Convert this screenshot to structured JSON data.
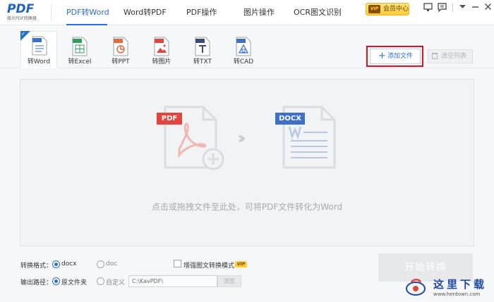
{
  "logo": {
    "main": "PDF",
    "sub": "极光PDF转换器"
  },
  "nav": {
    "tabs": [
      {
        "label": "PDF转Word"
      },
      {
        "label": "Word转PDF"
      },
      {
        "label": "PDF操作"
      },
      {
        "label": "图片操作"
      },
      {
        "label": "OCR图文识别"
      }
    ],
    "active_index": 0
  },
  "topbar": {
    "vip_label": "会员中心",
    "vip_badge": "VIP"
  },
  "tools": [
    {
      "label": "转Word",
      "tag": "DOC",
      "color": "#3c71c9"
    },
    {
      "label": "转Excel",
      "tag": "XLS",
      "color": "#2f9e5a"
    },
    {
      "label": "转PPT",
      "tag": "PPT",
      "color": "#e8693c"
    },
    {
      "label": "转图片",
      "tag": "JPG",
      "color": "#e8423c"
    },
    {
      "label": "转TXT",
      "tag": "TXT",
      "color": "#3a4a7a"
    },
    {
      "label": "转CAD",
      "tag": "DWG",
      "color": "#3c71c9"
    }
  ],
  "actions": {
    "add_label": "添加文件",
    "clear_label": "清空列表"
  },
  "dropzone": {
    "hint": "点击或拖拽文件至此处，可将PDF文件转化为Word",
    "source_tag": "PDF",
    "target_tag": "DOCX"
  },
  "options": {
    "format_label": "转换格式：",
    "format_options": [
      "docx",
      "doc"
    ],
    "format_selected": "docx",
    "enhance_label": "增强图文转换模式",
    "enhance_badge": "VIP",
    "output_label": "输出路径：",
    "output_options": [
      "原文件夹",
      "自定义"
    ],
    "output_selected": "原文件夹",
    "path_value": "C:\\KavPDF\\",
    "browse_label": "浏览"
  },
  "start_label": "开始转换",
  "watermark": {
    "text": "这里下载",
    "url": "www.herdown.com"
  }
}
